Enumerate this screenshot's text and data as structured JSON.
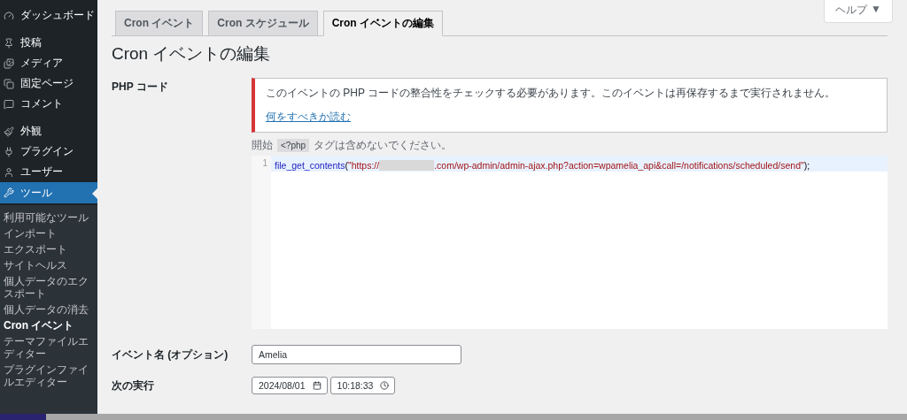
{
  "sidebar": {
    "menu_groups": [
      [
        {
          "label": "ダッシュボード",
          "selected": false
        }
      ],
      [
        {
          "label": "投稿",
          "selected": false
        },
        {
          "label": "メディア",
          "selected": false
        },
        {
          "label": "固定ページ",
          "selected": false
        },
        {
          "label": "コメント",
          "selected": false
        }
      ],
      [
        {
          "label": "外観",
          "selected": false
        },
        {
          "label": "プラグイン",
          "selected": false
        },
        {
          "label": "ユーザー",
          "selected": false
        },
        {
          "label": "ツール",
          "selected": true
        }
      ]
    ],
    "submenu": [
      {
        "label": "利用可能なツール",
        "selected": false
      },
      {
        "label": "インポート",
        "selected": false
      },
      {
        "label": "エクスポート",
        "selected": false
      },
      {
        "label": "サイトヘルス",
        "selected": false
      },
      {
        "label": "個人データのエクスポート",
        "selected": false
      },
      {
        "label": "個人データの消去",
        "selected": false
      },
      {
        "label": "Cron イベント",
        "selected": true
      },
      {
        "label": "テーマファイルエディター",
        "selected": false
      },
      {
        "label": "プラグインファイルエディター",
        "selected": false
      }
    ]
  },
  "help": {
    "label": "ヘルプ",
    "caret": "▼"
  },
  "tabs": [
    {
      "label": "Cron イベント",
      "selected": false
    },
    {
      "label": "Cron スケジュール",
      "selected": false
    },
    {
      "label": "Cron イベントの編集",
      "selected": true
    }
  ],
  "title": "Cron イベントの編集",
  "php_code": {
    "label": "PHP コード",
    "notice": {
      "message": "このイベントの PHP コードの整合性をチェックする必要があります。このイベントは再保存するまで実行されません。",
      "link": "何をすべきか読む"
    },
    "hint": {
      "before": "開始",
      "tag": "<?php",
      "after": "タグは含めないでください。"
    },
    "editor": {
      "lines": [
        {
          "number": "1",
          "tokens": [
            {
              "kind": "function",
              "text": "file_get_contents"
            },
            {
              "kind": "punct",
              "text": "("
            },
            {
              "kind": "string",
              "text": "\"https://"
            },
            {
              "kind": "redacted"
            },
            {
              "kind": "string",
              "text": ".com/wp-admin/admin-ajax.php?action=wpamelia_api&call=/notifications/scheduled/send\""
            },
            {
              "kind": "punct",
              "text": ");"
            }
          ]
        }
      ]
    }
  },
  "event_name": {
    "label": "イベント名 (オプション)",
    "value": "Amelia"
  },
  "next_run": {
    "label": "次の実行",
    "date": "2024/08/01",
    "time": "10:18:33"
  }
}
